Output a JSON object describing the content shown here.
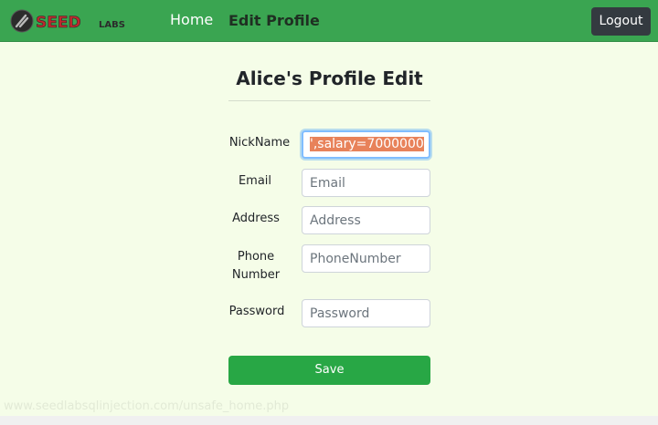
{
  "nav": {
    "logo_text": "SEEDLABS",
    "home_label": "Home",
    "edit_profile_label": "Edit Profile",
    "logout_label": "Logout"
  },
  "page": {
    "title": "Alice's Profile Edit"
  },
  "form": {
    "nickname": {
      "label": "NickName",
      "value": "',salary=7000000"
    },
    "email": {
      "label": "Email",
      "placeholder": "Email"
    },
    "address": {
      "label": "Address",
      "placeholder": "Address"
    },
    "phone": {
      "label_line1": "Phone",
      "label_line2": "Number",
      "placeholder": "PhoneNumber"
    },
    "password": {
      "label": "Password",
      "placeholder": "Password"
    },
    "save_label": "Save"
  },
  "status_bar": {
    "url": "www.seedlabsqlinjection.com/unsafe_home.php"
  },
  "colors": {
    "navbar": "#3aa551",
    "page_background": "#f5fde8",
    "save_button": "#28a745",
    "logout_button": "#343a40",
    "selection_highlight": "#e8825a"
  }
}
